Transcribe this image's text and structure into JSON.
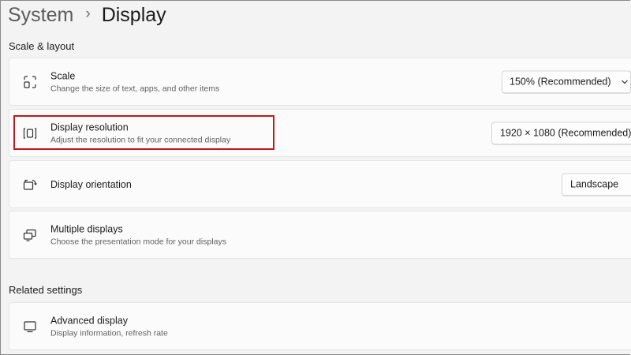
{
  "breadcrumb": {
    "parent": "System",
    "separator": "›",
    "current": "Display"
  },
  "sections": {
    "scale_layout": "Scale & layout",
    "related": "Related settings"
  },
  "cards": {
    "scale": {
      "title": "Scale",
      "description": "Change the size of text, apps, and other items",
      "value": "150% (Recommended)",
      "icon": "scale-icon"
    },
    "resolution": {
      "title": "Display resolution",
      "description": "Adjust the resolution to fit your connected display",
      "value": "1920 × 1080 (Recommended)",
      "icon": "resolution-icon"
    },
    "orientation": {
      "title": "Display orientation",
      "value": "Landscape",
      "icon": "orientation-icon"
    },
    "multiple": {
      "title": "Multiple displays",
      "description": "Choose the presentation mode for your displays",
      "icon": "multiple-displays-icon"
    },
    "advanced": {
      "title": "Advanced display",
      "description": "Display information, refresh rate",
      "icon": "monitor-icon"
    }
  },
  "colors": {
    "highlight": "#c4161c",
    "background": "#f3f3f3",
    "card": "#fbfbfb"
  }
}
